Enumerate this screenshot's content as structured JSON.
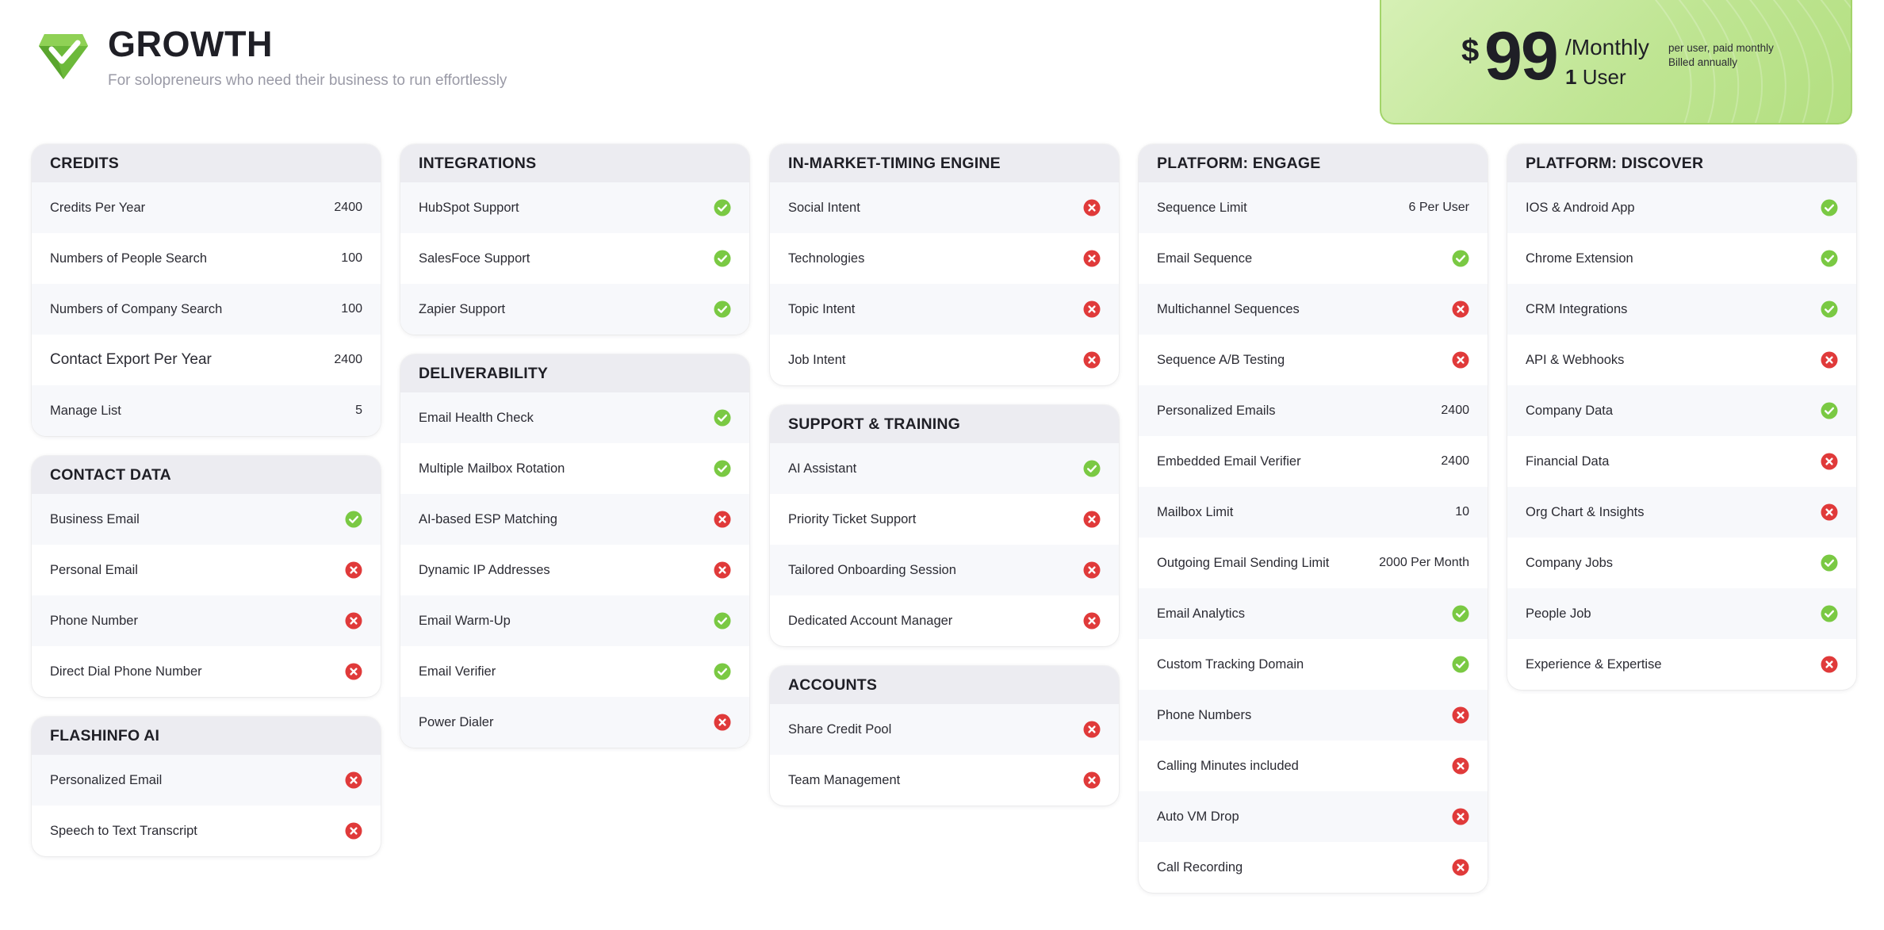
{
  "plan": {
    "name": "GROWTH",
    "tagline": "For solopreneurs who need their business to run effortlessly"
  },
  "pricing": {
    "currency": "$",
    "amount": "99",
    "period": "/Monthly",
    "user_count": "1",
    "user_label": "User",
    "note_line1": "per user, paid monthly",
    "note_line2": "Billed annually"
  },
  "colors": {
    "check": "#7ac943",
    "cross": "#e03a3a",
    "accent_green": "#bfe593",
    "header_bg": "#ececf1"
  },
  "cards": [
    {
      "id": "credits",
      "title": "CREDITS",
      "rows": [
        {
          "label": "Credits Per Year",
          "value": "2400"
        },
        {
          "label": "Numbers of People Search",
          "value": "100"
        },
        {
          "label": "Numbers of Company Search",
          "value": "100"
        },
        {
          "label": "Contact Export Per Year",
          "value": "2400",
          "big": true
        },
        {
          "label": "Manage List",
          "value": "5"
        }
      ]
    },
    {
      "id": "contact-data",
      "title": "CONTACT DATA",
      "rows": [
        {
          "label": "Business Email",
          "status": "check-icon"
        },
        {
          "label": "Personal Email",
          "status": "cross-icon"
        },
        {
          "label": "Phone Number",
          "status": "cross-icon"
        },
        {
          "label": "Direct Dial Phone Number",
          "status": "cross-icon"
        }
      ]
    },
    {
      "id": "flashinfo-ai",
      "title": "FLASHINFO AI",
      "rows": [
        {
          "label": "Personalized Email",
          "status": "cross-icon"
        },
        {
          "label": "Speech to Text Transcript",
          "status": "cross-icon"
        }
      ]
    },
    {
      "id": "integrations",
      "title": "INTEGRATIONS",
      "rows": [
        {
          "label": "HubSpot Support",
          "status": "check-icon"
        },
        {
          "label": "SalesFoce Support",
          "status": "check-icon"
        },
        {
          "label": "Zapier Support",
          "status": "check-icon"
        }
      ]
    },
    {
      "id": "deliverability",
      "title": "DELIVERABILITY",
      "rows": [
        {
          "label": "Email Health Check",
          "status": "check-icon"
        },
        {
          "label": "Multiple Mailbox Rotation",
          "status": "check-icon"
        },
        {
          "label": "AI-based ESP Matching",
          "status": "cross-icon"
        },
        {
          "label": "Dynamic IP Addresses",
          "status": "cross-icon"
        },
        {
          "label": "Email Warm-Up",
          "status": "check-icon"
        },
        {
          "label": "Email Verifier",
          "status": "check-icon"
        },
        {
          "label": "Power Dialer",
          "status": "cross-icon"
        }
      ]
    },
    {
      "id": "in-market-timing-engine",
      "title": "IN-MARKET-TIMING ENGINE",
      "rows": [
        {
          "label": "Social Intent",
          "status": "cross-icon"
        },
        {
          "label": "Technologies",
          "status": "cross-icon"
        },
        {
          "label": "Topic Intent",
          "status": "cross-icon"
        },
        {
          "label": "Job Intent",
          "status": "cross-icon"
        }
      ]
    },
    {
      "id": "support-training",
      "title": "SUPPORT & TRAINING",
      "rows": [
        {
          "label": "AI Assistant",
          "status": "check-icon"
        },
        {
          "label": "Priority Ticket Support",
          "status": "cross-icon"
        },
        {
          "label": "Tailored Onboarding Session",
          "status": "cross-icon"
        },
        {
          "label": "Dedicated Account Manager",
          "status": "cross-icon"
        }
      ]
    },
    {
      "id": "accounts",
      "title": "ACCOUNTS",
      "rows": [
        {
          "label": "Share Credit Pool",
          "status": "cross-icon"
        },
        {
          "label": "Team Management",
          "status": "cross-icon"
        }
      ]
    },
    {
      "id": "platform-engage",
      "title": "PLATFORM: ENGAGE",
      "rows": [
        {
          "label": "Sequence Limit",
          "value": "6 Per User"
        },
        {
          "label": "Email Sequence",
          "status": "check-icon"
        },
        {
          "label": "Multichannel Sequences",
          "status": "cross-icon"
        },
        {
          "label": "Sequence A/B Testing",
          "status": "cross-icon"
        },
        {
          "label": "Personalized Emails",
          "value": "2400"
        },
        {
          "label": "Embedded Email Verifier",
          "value": "2400"
        },
        {
          "label": "Mailbox Limit",
          "value": "10"
        },
        {
          "label": "Outgoing Email Sending Limit",
          "value": "2000 Per Month"
        },
        {
          "label": "Email Analytics",
          "status": "check-icon"
        },
        {
          "label": "Custom Tracking Domain",
          "status": "check-icon"
        },
        {
          "label": "Phone Numbers",
          "status": "cross-icon"
        },
        {
          "label": "Calling Minutes included",
          "status": "cross-icon"
        },
        {
          "label": "Auto VM Drop",
          "status": "cross-icon"
        },
        {
          "label": "Call Recording",
          "status": "cross-icon"
        }
      ]
    },
    {
      "id": "platform-discover",
      "title": "PLATFORM: DISCOVER",
      "rows": [
        {
          "label": "IOS & Android App",
          "status": "check-icon"
        },
        {
          "label": "Chrome Extension",
          "status": "check-icon"
        },
        {
          "label": "CRM Integrations",
          "status": "check-icon"
        },
        {
          "label": "API & Webhooks",
          "status": "cross-icon"
        },
        {
          "label": "Company Data",
          "status": "check-icon"
        },
        {
          "label": "Financial Data",
          "status": "cross-icon"
        },
        {
          "label": "Org Chart & Insights",
          "status": "cross-icon"
        },
        {
          "label": "Company Jobs",
          "status": "check-icon"
        },
        {
          "label": "People Job",
          "status": "check-icon"
        },
        {
          "label": "Experience & Expertise",
          "status": "cross-icon"
        }
      ]
    }
  ]
}
